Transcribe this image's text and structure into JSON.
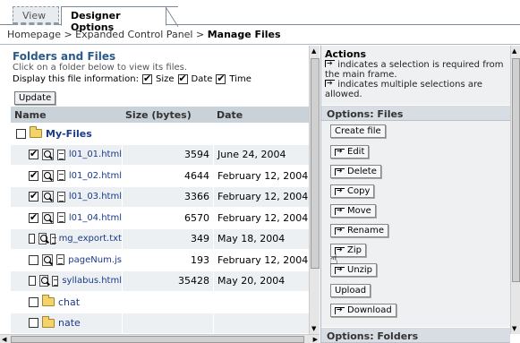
{
  "tabs": {
    "view": "View",
    "designer": "Designer Options"
  },
  "breadcrumb": {
    "path": "Homepage > Expanded Control Panel > ",
    "current": "Manage Files"
  },
  "left": {
    "title": "Folders and Files",
    "hint": "Click on a folder below to view its files.",
    "display_label": "Display this file information:",
    "opt_size": "Size",
    "opt_date": "Date",
    "opt_time": "Time",
    "update": "Update"
  },
  "table": {
    "headers": [
      "Name",
      "Size (bytes)",
      "Date"
    ],
    "rows": [
      {
        "name": "My-Files",
        "size": "",
        "date": "",
        "type": "folder",
        "checked": false
      },
      {
        "name": "l01_01.html",
        "size": "3594",
        "date": "June 24, 2004",
        "type": "file",
        "checked": true
      },
      {
        "name": "l01_02.html",
        "size": "4644",
        "date": "February 12, 2004",
        "type": "file",
        "checked": true
      },
      {
        "name": "l01_03.html",
        "size": "3366",
        "date": "February 12, 2004",
        "type": "file",
        "checked": true
      },
      {
        "name": "l01_04.html",
        "size": "6570",
        "date": "February 12, 2004",
        "type": "file",
        "checked": true
      },
      {
        "name": "mg_export.txt",
        "size": "349",
        "date": "May 18, 2004",
        "type": "file",
        "checked": false
      },
      {
        "name": "pageNum.js",
        "size": "193",
        "date": "February 12, 2004",
        "type": "file",
        "checked": false
      },
      {
        "name": "syllabus.html",
        "size": "35428",
        "date": "May 20, 2004",
        "type": "file",
        "checked": false
      },
      {
        "name": "chat",
        "size": "",
        "date": "",
        "type": "subfolder",
        "checked": false
      },
      {
        "name": "nate",
        "size": "",
        "date": "",
        "type": "subfolder",
        "checked": false
      }
    ]
  },
  "actions": {
    "title": "Actions",
    "note1": "indicates a selection is required from the main frame.",
    "note2": "indicates multiple selections are allowed.",
    "files_header": "Options: Files",
    "folders_header": "Options: Folders",
    "create_file": "Create file",
    "edit": "Edit",
    "delete": "Delete",
    "copy": "Copy",
    "move": "Move",
    "rename": "Rename",
    "zip": "Zip",
    "unzip": "Unzip",
    "upload": "Upload",
    "download": "Download"
  }
}
